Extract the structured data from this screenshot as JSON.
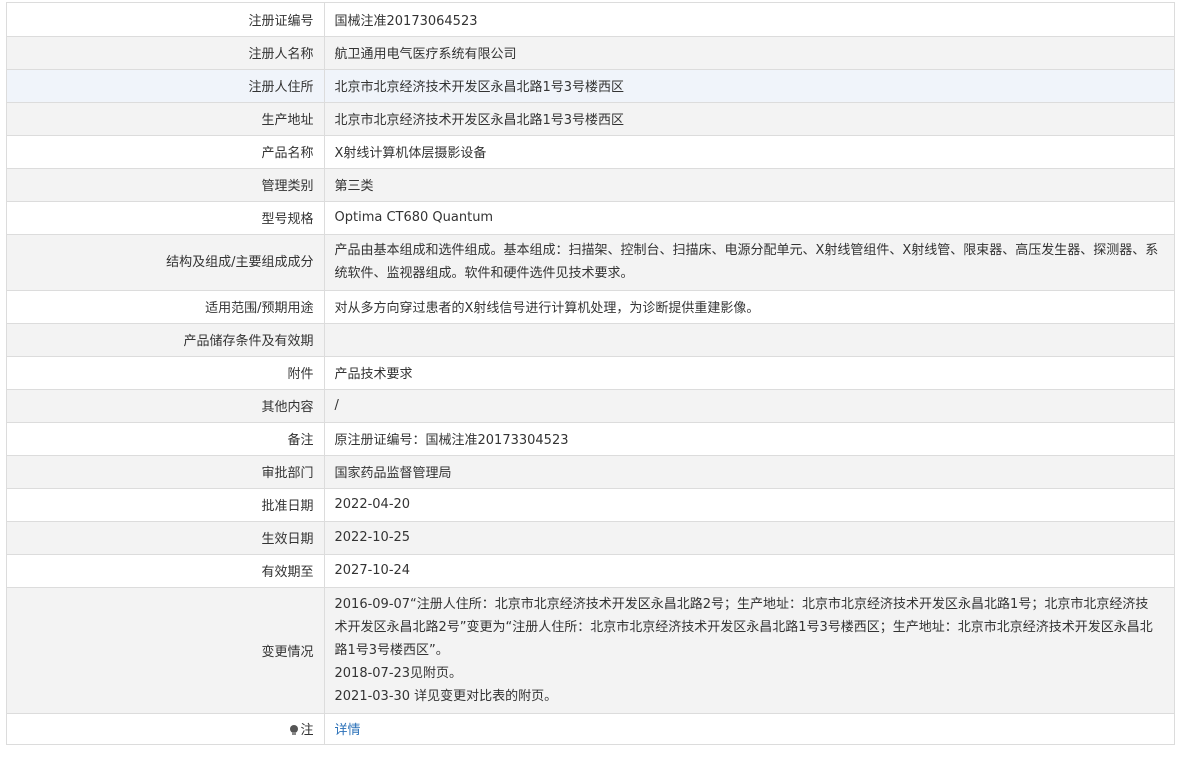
{
  "rows": [
    {
      "label": "注册证编号",
      "value": "国械注准20173064523"
    },
    {
      "label": "注册人名称",
      "value": "航卫通用电气医疗系统有限公司"
    },
    {
      "label": "注册人住所",
      "value": "北京市北京经济技术开发区永昌北路1号3号楼西区"
    },
    {
      "label": "生产地址",
      "value": "北京市北京经济技术开发区永昌北路1号3号楼西区"
    },
    {
      "label": "产品名称",
      "value": "X射线计算机体层摄影设备"
    },
    {
      "label": "管理类别",
      "value": "第三类"
    },
    {
      "label": "型号规格",
      "value": "Optima CT680 Quantum"
    },
    {
      "label": "结构及组成/主要组成成分",
      "value": "产品由基本组成和选件组成。基本组成：扫描架、控制台、扫描床、电源分配单元、X射线管组件、X射线管、限束器、高压发生器、探测器、系统软件、监视器组成。软件和硬件选件见技术要求。"
    },
    {
      "label": "适用范围/预期用途",
      "value": "对从多方向穿过患者的X射线信号进行计算机处理，为诊断提供重建影像。"
    },
    {
      "label": "产品储存条件及有效期",
      "value": ""
    },
    {
      "label": "附件",
      "value": "产品技术要求"
    },
    {
      "label": "其他内容",
      "value": "/"
    },
    {
      "label": "备注",
      "value": "原注册证编号：国械注准20173304523"
    },
    {
      "label": "审批部门",
      "value": "国家药品监督管理局"
    },
    {
      "label": "批准日期",
      "value": "2022-04-20"
    },
    {
      "label": "生效日期",
      "value": "2022-10-25"
    },
    {
      "label": "有效期至",
      "value": "2027-10-24"
    }
  ],
  "change": {
    "label": "变更情况",
    "lines": [
      "2016-09-07“注册人住所：北京市北京经济技术开发区永昌北路2号；生产地址：北京市北京经济技术开发区永昌北路1号；北京市北京经济技术开发区永昌北路2号”变更为“注册人住所：北京市北京经济技术开发区永昌北路1号3号楼西区；生产地址：北京市北京经济技术开发区永昌北路1号3号楼西区”。",
      "2018-07-23见附页。",
      "2021-03-30 详见变更对比表的附页。"
    ]
  },
  "note": {
    "icon": "lightbulb-icon",
    "label": "注",
    "link": "详情",
    "link_color": "#2a70b8"
  }
}
